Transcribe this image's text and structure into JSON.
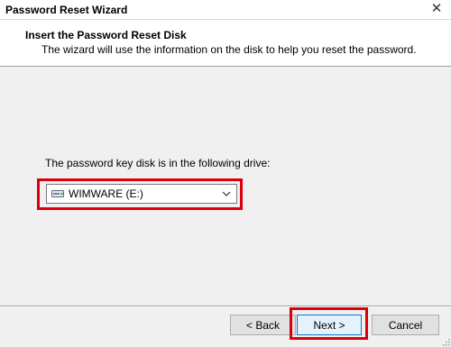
{
  "window": {
    "title": "Password Reset Wizard",
    "close_glyph": "✕"
  },
  "header": {
    "title": "Insert the Password Reset Disk",
    "subtitle": "The wizard will use the information on the disk to help you reset the password."
  },
  "main": {
    "drive_label": "The password key disk is in the following drive:",
    "drive_select": {
      "selected_value": "WIMWARE (E:)",
      "icon": "usb-drive-icon"
    }
  },
  "buttons": {
    "back_label": "< Back",
    "next_label": "Next >",
    "cancel_label": "Cancel"
  },
  "colors": {
    "highlight": "#d9000a",
    "focus_border": "#0078d7"
  }
}
